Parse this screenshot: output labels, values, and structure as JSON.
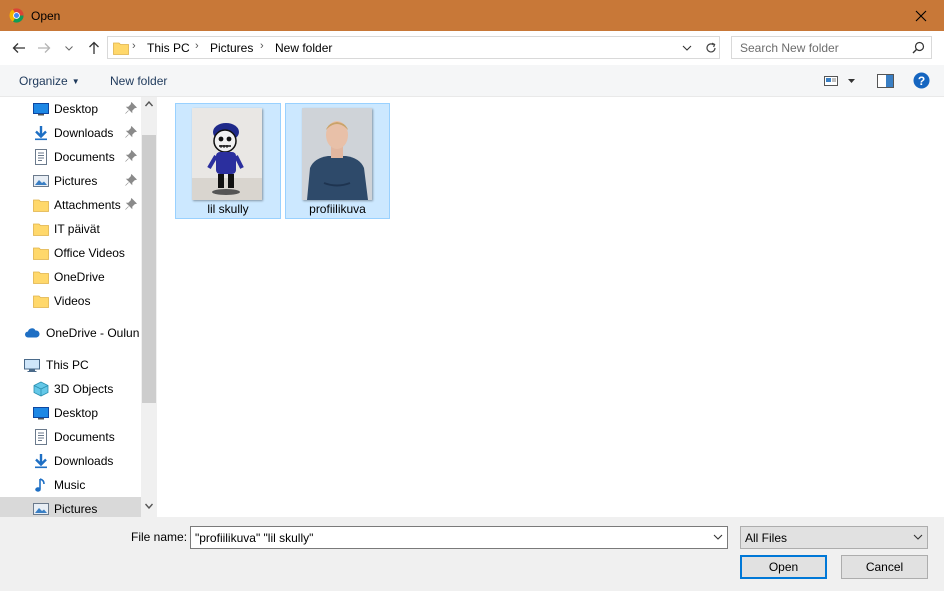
{
  "window": {
    "title": "Open",
    "titlebar_color": "#c87838",
    "app_icon": "chrome-icon",
    "close_icon": "close-icon"
  },
  "navigation": {
    "back_icon": "back-arrow-icon",
    "forward_icon": "forward-arrow-icon",
    "recent_icon": "chevron-down-icon",
    "up_icon": "up-arrow-icon",
    "breadcrumbs": [
      "This PC",
      "Pictures",
      "New folder"
    ],
    "refresh_icon": "refresh-icon"
  },
  "search": {
    "placeholder": "Search New folder",
    "icon": "search-icon"
  },
  "toolbar": {
    "organize_label": "Organize",
    "new_folder_label": "New folder",
    "view_icon": "view-options-icon",
    "preview_icon": "preview-pane-icon",
    "help_icon": "help-icon"
  },
  "sidebar": {
    "quick_access": [
      {
        "label": "Desktop",
        "icon": "desktop-icon",
        "pinned": true
      },
      {
        "label": "Downloads",
        "icon": "download-icon",
        "pinned": true
      },
      {
        "label": "Documents",
        "icon": "documents-icon",
        "pinned": true
      },
      {
        "label": "Pictures",
        "icon": "pictures-icon",
        "pinned": true
      },
      {
        "label": "Attachments",
        "icon": "folder-icon",
        "pinned": true
      },
      {
        "label": "IT päivät",
        "icon": "folder-icon",
        "pinned": false
      },
      {
        "label": "Office Videos",
        "icon": "folder-icon",
        "pinned": false
      },
      {
        "label": "OneDrive",
        "icon": "folder-icon",
        "pinned": false
      },
      {
        "label": "Videos",
        "icon": "folder-icon",
        "pinned": false
      }
    ],
    "onedrive": {
      "label": "OneDrive - Oulun",
      "icon": "cloud-icon"
    },
    "this_pc": {
      "label": "This PC",
      "icon": "computer-icon"
    },
    "this_pc_items": [
      {
        "label": "3D Objects",
        "icon": "cube-icon"
      },
      {
        "label": "Desktop",
        "icon": "desktop-icon"
      },
      {
        "label": "Documents",
        "icon": "documents-icon"
      },
      {
        "label": "Downloads",
        "icon": "download-icon"
      },
      {
        "label": "Music",
        "icon": "music-icon"
      },
      {
        "label": "Pictures",
        "icon": "pictures-icon",
        "selected": true
      }
    ]
  },
  "files": [
    {
      "name": "lil skully",
      "selected": true
    },
    {
      "name": "profiilikuva",
      "selected": true
    }
  ],
  "footer": {
    "file_name_label": "File name:",
    "file_name_value": "\"profiilikuva\" \"lil skully\"",
    "file_type_value": "All Files",
    "open_label": "Open",
    "cancel_label": "Cancel"
  },
  "colors": {
    "selection_bg": "#cce8ff",
    "selection_border": "#99d1ff",
    "accent": "#0078d7",
    "link": "#1e395b"
  }
}
